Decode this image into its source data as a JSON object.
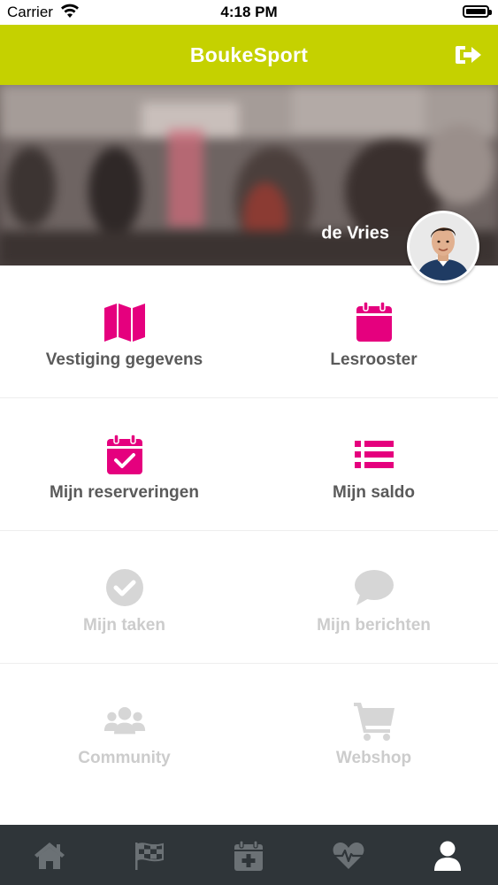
{
  "status_bar": {
    "carrier": "Carrier",
    "time": "4:18 PM"
  },
  "header": {
    "title": "BoukeSport",
    "logout_icon": "sign-out-icon"
  },
  "hero": {
    "username": "de Vries",
    "avatar_icon": "user-avatar"
  },
  "menu": {
    "rows": [
      [
        {
          "label": "Vestiging gegevens",
          "icon": "map-icon",
          "state": "active"
        },
        {
          "label": "Lesrooster",
          "icon": "calendar-icon",
          "state": "active"
        }
      ],
      [
        {
          "label": "Mijn reserveringen",
          "icon": "calendar-check-icon",
          "state": "active"
        },
        {
          "label": "Mijn saldo",
          "icon": "list-icon",
          "state": "active"
        }
      ],
      [
        {
          "label": "Mijn taken",
          "icon": "check-circle-icon",
          "state": "inactive"
        },
        {
          "label": "Mijn berichten",
          "icon": "comment-icon",
          "state": "inactive"
        }
      ],
      [
        {
          "label": "Community",
          "icon": "users-icon",
          "state": "inactive"
        },
        {
          "label": "Webshop",
          "icon": "shopping-cart-icon",
          "state": "inactive"
        }
      ]
    ]
  },
  "tab_bar": {
    "tabs": [
      {
        "icon": "home-icon"
      },
      {
        "icon": "checkered-flag-icon"
      },
      {
        "icon": "calendar-plus-icon"
      },
      {
        "icon": "heartbeat-icon"
      },
      {
        "icon": "user-icon"
      }
    ]
  },
  "colors": {
    "brand": "#c5d100",
    "accent": "#e5007e",
    "inactive": "#d6d6d6",
    "tab_bar_bg": "#2f3539",
    "tab_icon": "#6b7175",
    "tab_icon_active": "#ffffff"
  }
}
